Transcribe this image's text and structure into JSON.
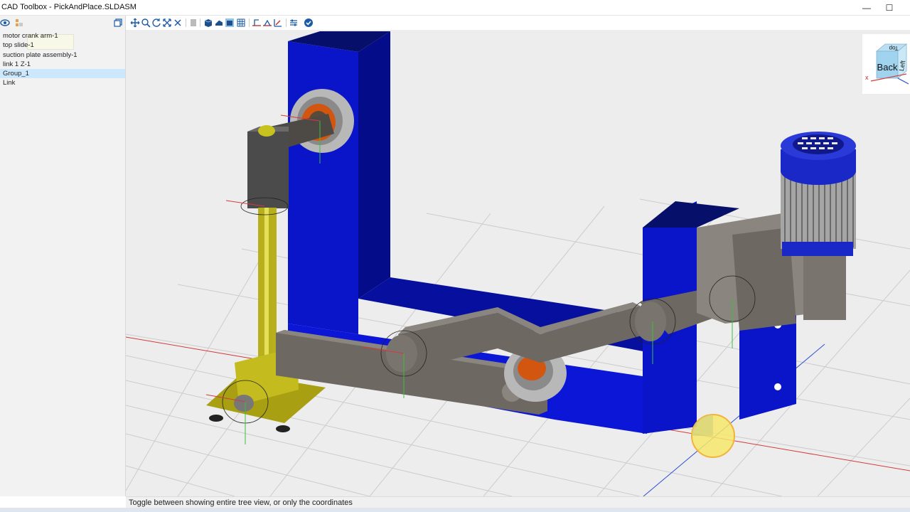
{
  "window": {
    "title": "CAD Toolbox - PickAndPlace.SLDASM",
    "minimize_glyph": "—",
    "maximize_glyph": "☐"
  },
  "tree": {
    "items": [
      {
        "label": "motor crank arm-1",
        "selected": false
      },
      {
        "label": "top slide-1",
        "selected": false
      },
      {
        "label": "suction plate assembly-1",
        "selected": false
      },
      {
        "label": "link 1 Z-1",
        "selected": false
      },
      {
        "label": "Group_1",
        "selected": true
      },
      {
        "label": "Link",
        "selected": false
      }
    ]
  },
  "toolbar": {
    "icons": [
      "pan-icon",
      "zoom-icon",
      "rotate-icon",
      "zoom-fit-icon",
      "fit-all-icon",
      "display-icon",
      "shaded-icon",
      "shaded-edges-icon",
      "hidden-lines-icon",
      "wireframe-icon",
      "section-icon",
      "measure-icon",
      "mate-icon",
      "settings-icon",
      "check-icon"
    ]
  },
  "viewcube": {
    "face_front": "Back",
    "face_side": "Left",
    "face_top": "Top",
    "axis_label": "x"
  },
  "status": {
    "text": "Toggle between showing entire tree view, or only the coordinates"
  },
  "colors": {
    "frame_blue": "#0a14c8",
    "arm_gray": "#6e6862",
    "rod_yellow": "#b7b01c",
    "bearing_orange": "#d2560f",
    "grid_line": "#c9c9c9",
    "background": "#ededed",
    "selection": "#cce8ff"
  }
}
